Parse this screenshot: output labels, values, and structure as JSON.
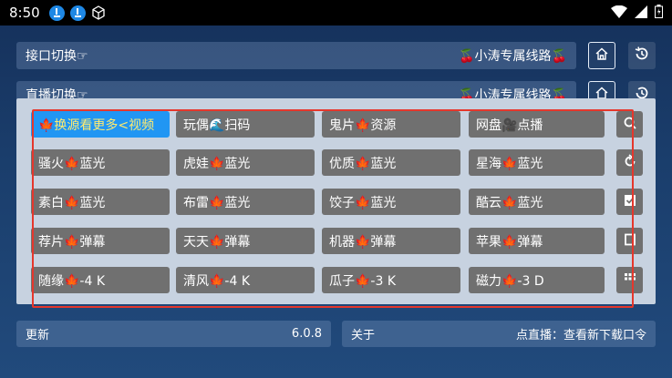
{
  "status_bar": {
    "time": "8:50"
  },
  "rows": {
    "interface": {
      "label": "接口切换☞",
      "value": "🍒小涛专属线路🍒"
    },
    "live": {
      "label": "直播切换☞",
      "value": "🍒小涛专属线路🍒"
    }
  },
  "grid": [
    [
      "🍁换源看更多<视频",
      "玩偶🌊扫码",
      "鬼片🍁资源",
      "网盘🎥点播"
    ],
    [
      "骚火🍁蓝光",
      "虎娃🍁蓝光",
      "优质🍁蓝光",
      "星海🍁蓝光"
    ],
    [
      "素白🍁蓝光",
      "布雷🍁蓝光",
      "饺子🍁蓝光",
      "酷云🍁蓝光"
    ],
    [
      "荐片🍁弹幕",
      "天天🍁弹幕",
      "机器🍁弹幕",
      "苹果🍁弹幕"
    ],
    [
      "随缘🍁-4 K",
      "清风🍁-4 K",
      "瓜子🍁-3 K",
      "磁力🍁-3 D"
    ]
  ],
  "bottom": {
    "update_label": "更新",
    "version": "6.0.8",
    "about_label": "关于",
    "about_value": "点直播：查看新下载口令"
  },
  "colors": {
    "accent": "#2196f3",
    "highlight_border": "#e5372c",
    "item_bg": "#707070",
    "panel_bg": "#c7d2e0"
  },
  "icons": {
    "side_column": [
      "search-icon",
      "refresh-icon",
      "checkbox-icon",
      "square-icon",
      "grid-icon"
    ]
  }
}
